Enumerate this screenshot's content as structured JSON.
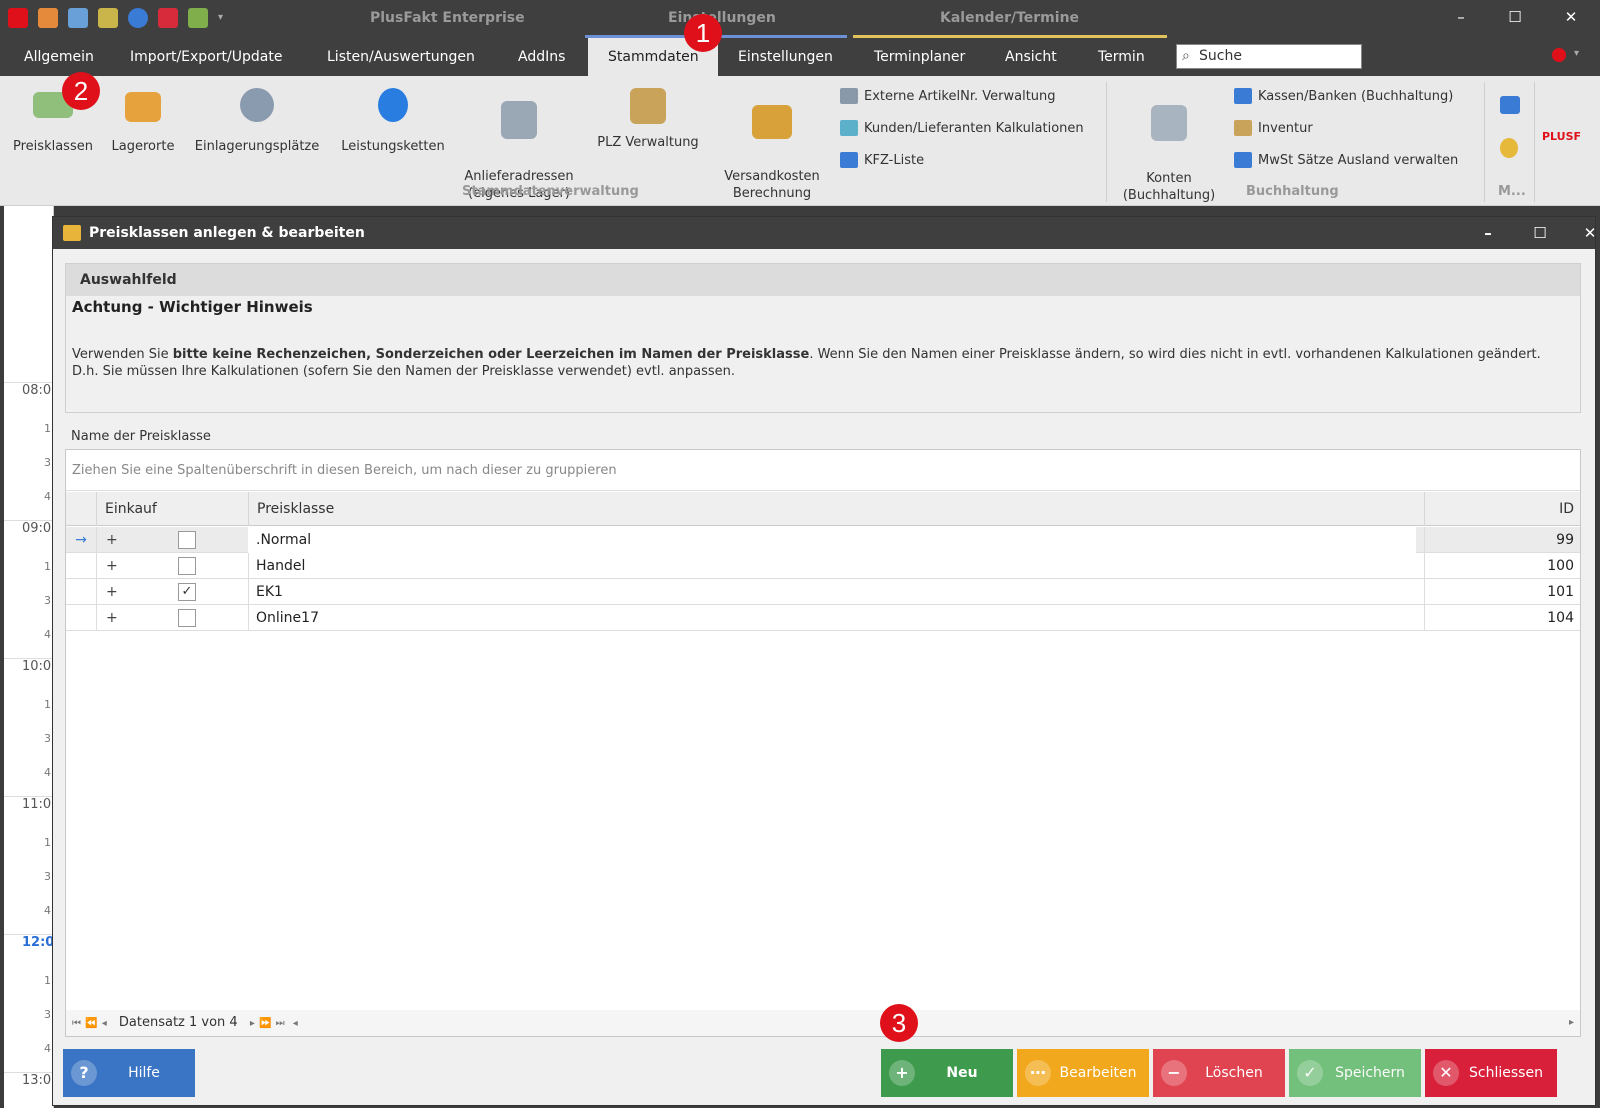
{
  "titlebar": {
    "app_title": "PlusFakt Enterprise",
    "context_tab_1": "Einstellungen",
    "context_tab_2": "Kalender/Termine",
    "minimize": "–",
    "maximize": "☐",
    "close": "✕",
    "qat_icons": [
      "plusfakt-logo-icon",
      "users-icon",
      "documents-icon",
      "money-icon",
      "help-icon",
      "swiss-icon",
      "calendar-icon",
      "dropdown-icon"
    ]
  },
  "tabs": [
    "Allgemein",
    "Import/Export/Update",
    "Listen/Auswertungen",
    "AddIns",
    "Stammdaten",
    "Einstellungen",
    "Terminplaner",
    "Ansicht",
    "Termin"
  ],
  "active_tab": "Stammdaten",
  "search": {
    "value": "Suche"
  },
  "ribbon": {
    "buttons": [
      {
        "label": "Preisklassen",
        "icon": "money-stack-icon"
      },
      {
        "label": "Lagerorte",
        "icon": "factory-icon"
      },
      {
        "label": "Einlagerungsplätze",
        "icon": "cart-icon"
      },
      {
        "label": "Leistungsketten",
        "icon": "chain-link-icon"
      },
      {
        "label": "Anlieferadressen\n(eigenes Lager)",
        "icon": "warehouse-icon"
      },
      {
        "label": "PLZ Verwaltung",
        "icon": "house-icon"
      },
      {
        "label": "Versandkosten\nBerechnung",
        "icon": "delivery-truck-icon"
      }
    ],
    "small_items": [
      "Externe ArtikelNr. Verwaltung",
      "Kunden/Lieferanten Kalkulationen",
      "KFZ-Liste"
    ],
    "group_stammdaten": "Stammdatenverwaltung",
    "konten": "Konten\n(Buchhaltung)",
    "buchhaltung_items": [
      "Kassen/Banken (Buchhaltung)",
      "Inventur",
      "MwSt Sätze Ausland verwalten"
    ],
    "group_buchhaltung": "Buchhaltung",
    "group_m": "M...",
    "brand": "PLUSF"
  },
  "calendar": {
    "hours": [
      "08:0",
      "09:0",
      "10:0",
      "11:0",
      "12:0",
      "13:0"
    ],
    "current_hour": "12:0"
  },
  "dialog": {
    "title": "Preisklassen anlegen & bearbeiten",
    "section_header": "Auswahlfeld",
    "warning_title": "Achtung  - Wichtiger Hinweis",
    "notice_prefix": "Verwenden Sie ",
    "notice_bold": "bitte keine Rechenzeichen, Sonderzeichen oder Leerzeichen im Namen der Preisklasse",
    "notice_suffix": ". Wenn Sie den Namen einer Preisklasse ändern, so wird dies nicht in evtl. vorhandenen Kalkulationen geändert. D.h. Sie müssen Ihre Kalkulationen (sofern Sie den Namen der Preisklasse verwendet) evtl. anpassen.",
    "field_label": "Name der Preisklasse",
    "group_panel_hint": "Ziehen Sie eine Spaltenüberschrift in diesen Bereich, um nach dieser zu gruppieren",
    "columns": {
      "einkauf": "Einkauf",
      "preisklasse": "Preisklasse",
      "id": "ID"
    },
    "rows": [
      {
        "expand": "+",
        "einkauf": false,
        "preisklasse": ".Normal",
        "id": "99"
      },
      {
        "expand": "+",
        "einkauf": false,
        "preisklasse": "Handel",
        "id": "100"
      },
      {
        "expand": "+",
        "einkauf": true,
        "preisklasse": "EK1",
        "id": "101"
      },
      {
        "expand": "+",
        "einkauf": false,
        "preisklasse": "Online17",
        "id": "104"
      }
    ],
    "pager_text": "Datensatz 1 von 4",
    "buttons": {
      "hilfe": "Hilfe",
      "neu": "Neu",
      "bearbeiten": "Bearbeiten",
      "loeschen": "Löschen",
      "speichern": "Speichern",
      "schliessen": "Schliessen"
    }
  },
  "badges": [
    "1",
    "2",
    "3"
  ],
  "colors": {
    "accent_red": "#e0101a",
    "btn_help": "#3a74c4",
    "btn_new": "#3e9a4c",
    "btn_edit": "#f2a81d",
    "btn_delete": "#e04450",
    "btn_save": "#48b055",
    "btn_close": "#d8203a"
  }
}
